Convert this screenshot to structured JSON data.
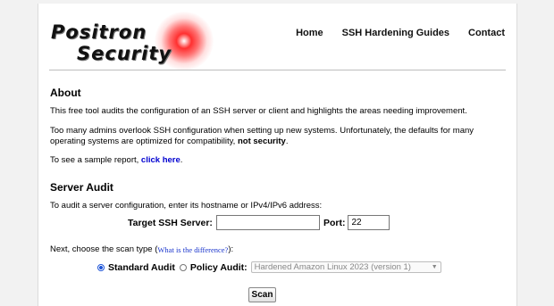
{
  "logo": {
    "line1": "Positron",
    "line2": "Security"
  },
  "nav": {
    "items": [
      "Home",
      "SSH Hardening Guides",
      "Contact"
    ]
  },
  "about": {
    "heading": "About",
    "p1": "This free tool audits the configuration of an SSH server or client and highlights the areas needing improvement.",
    "p2a": "Too many admins overlook SSH configuration when setting up new systems. Unfortunately, the defaults for many operating systems are optimized for compatibility, ",
    "p2b": "not security",
    "p2c": ".",
    "p3a": "To see a sample report, ",
    "p3_link": "click here",
    "p3c": "."
  },
  "audit": {
    "heading": "Server Audit",
    "intro": "To audit a server configuration, enter its hostname or IPv4/IPv6 address:",
    "target_label": "Target SSH Server:",
    "target_value": "",
    "port_label": "Port:",
    "port_value": "22",
    "scan_type_a": "Next, choose the scan type (",
    "scan_type_link": "What is the difference?",
    "scan_type_c": "):",
    "standard_label": "Standard Audit",
    "policy_label": "Policy Audit:",
    "policy_selected": "Hardened Amazon Linux 2023 (version 1)",
    "scan_button": "Scan"
  }
}
